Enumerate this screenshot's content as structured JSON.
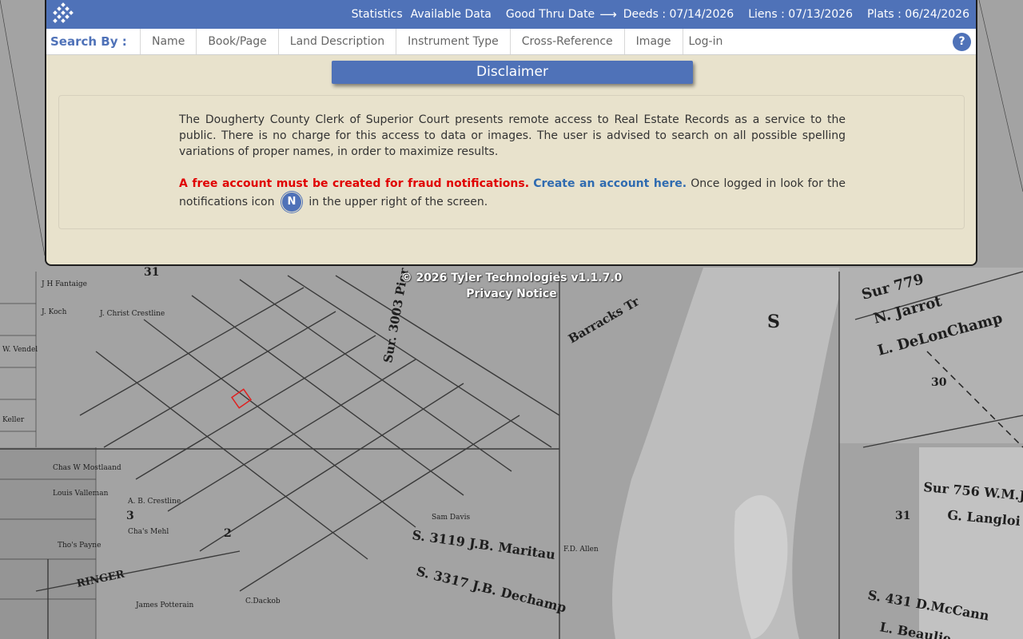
{
  "header": {
    "statistics_label": "Statistics",
    "available_data_label": "Available Data",
    "good_thru_label": "Good Thru Date",
    "arrow": "⟶",
    "deeds": "Deeds : 07/14/2026",
    "liens": "Liens : 07/13/2026",
    "plats": "Plats : 06/24/2026"
  },
  "nav": {
    "search_by": "Search By :",
    "items": [
      "Name",
      "Book/Page",
      "Land Description",
      "Instrument Type",
      "Cross-Reference",
      "Image",
      "Log-in"
    ],
    "help": "?"
  },
  "disclaimer": {
    "title": "Disclaimer",
    "paragraph": "The Dougherty County Clerk of Superior Court presents remote access to Real Estate Records as a service to the public. There is no charge for this access to data or images. The user is advised to search on all possible spelling variations of proper names, in order to maximize results.",
    "fraud_text": "A free account must be created for fraud notifications.",
    "create_link": "Create an account here.",
    "after_link": "Once logged in look for the notifications icon",
    "badge": "N",
    "after_badge": "in the upper right of the screen."
  },
  "footer": {
    "copyright": "© 2026 Tyler Technologies v1.1.7.0",
    "privacy": "Privacy Notice"
  },
  "colors": {
    "accent": "#4f72b8",
    "panel_bg": "#e8e2cc",
    "fraud_red": "#e00000",
    "link_blue": "#2f6bb0"
  }
}
